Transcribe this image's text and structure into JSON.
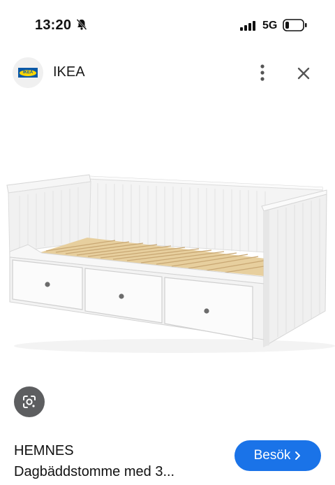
{
  "status_bar": {
    "time": "13:20",
    "network": "5G",
    "icons": [
      "bell-slash-icon",
      "signal-icon",
      "battery-icon"
    ]
  },
  "header": {
    "logo_text": "IKEA",
    "site_name": "IKEA",
    "icons": [
      "more-vert-icon",
      "close-icon"
    ]
  },
  "image": {
    "description_icon": "lens-search-icon"
  },
  "product": {
    "title": "HEMNES",
    "subtitle": "Dagbäddstomme med 3..."
  },
  "actions": {
    "visit_label": "Besök",
    "visit_icon": "chevron-right-icon"
  },
  "colors": {
    "accent": "#1a73e8",
    "lens_bg": "#5d5e60",
    "ikea_blue": "#0a58a6",
    "ikea_yellow": "#ffd600"
  }
}
